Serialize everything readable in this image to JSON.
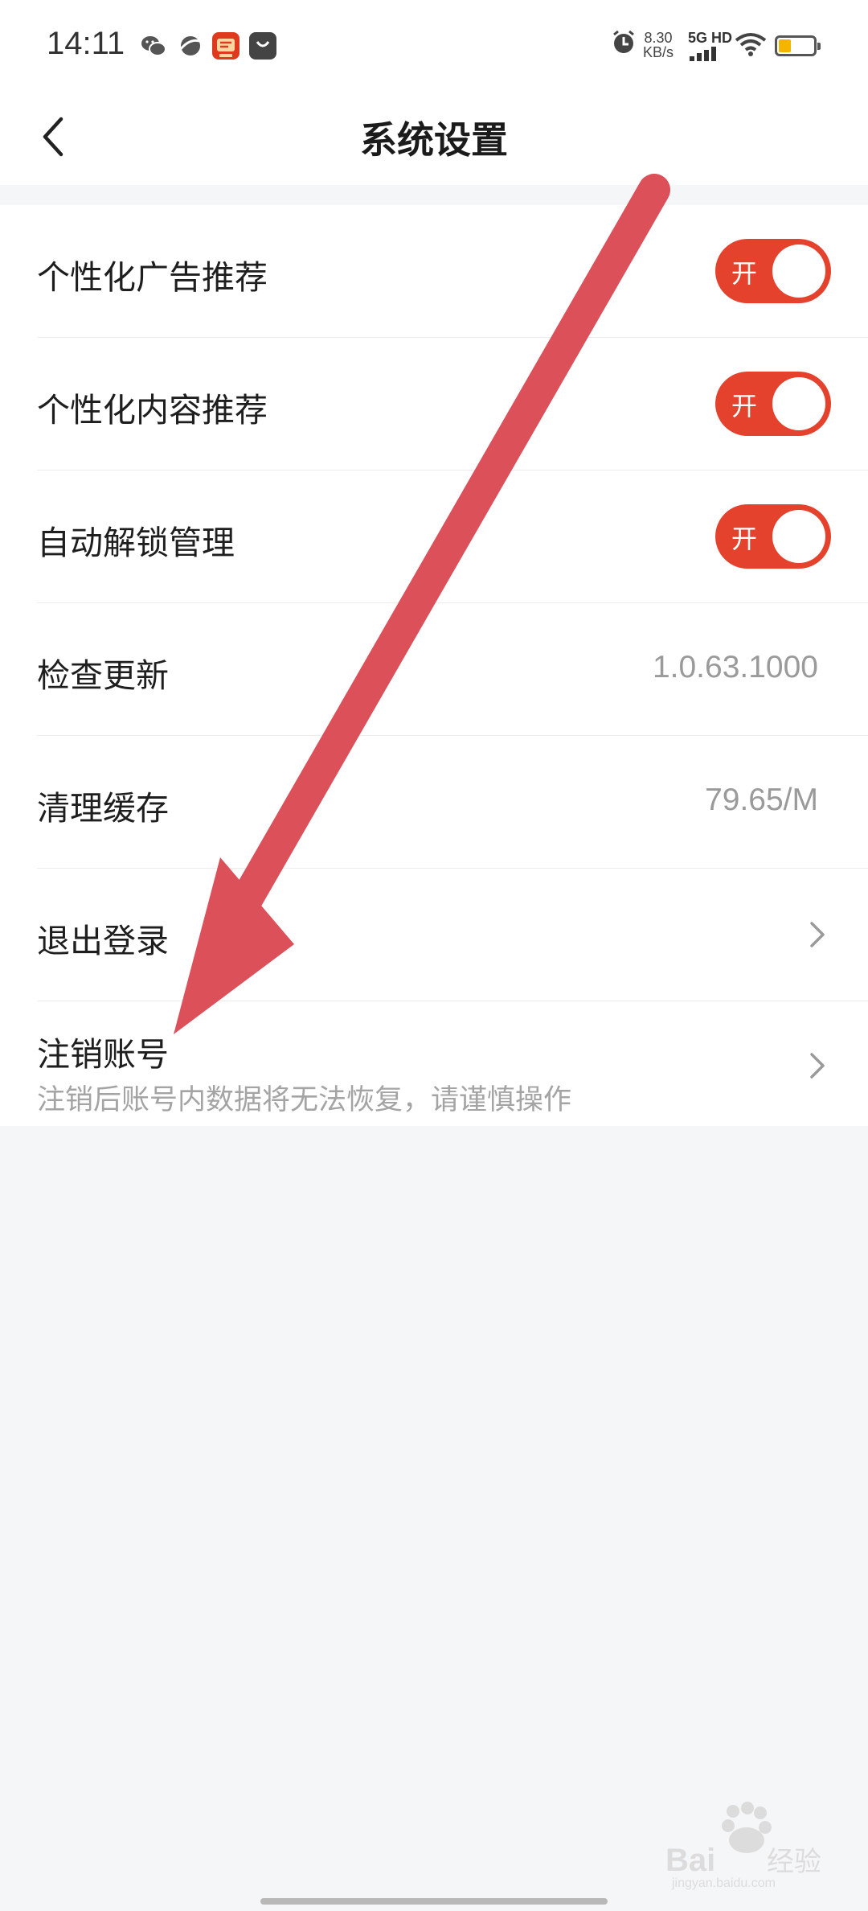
{
  "status_bar": {
    "time": "14:11",
    "app_icons": [
      "wechat-icon",
      "browser-icon",
      "taobao-icon",
      "shopping-bag-icon"
    ],
    "net_speed_value": "8.30",
    "net_speed_unit": "KB/s",
    "network_label": "5G HD",
    "battery_level": 0.35,
    "battery_color": "#f5b400"
  },
  "header": {
    "back_icon": "chevron-left-icon",
    "title": "系统设置"
  },
  "settings": {
    "items": [
      {
        "label": "个性化广告推荐",
        "type": "toggle",
        "toggle_text": "开",
        "on": true
      },
      {
        "label": "个性化内容推荐",
        "type": "toggle",
        "toggle_text": "开",
        "on": true
      },
      {
        "label": "自动解锁管理",
        "type": "toggle",
        "toggle_text": "开",
        "on": true
      },
      {
        "label": "检查更新",
        "type": "value",
        "value": "1.0.63.1000"
      },
      {
        "label": "清理缓存",
        "type": "value",
        "value": "79.65/M"
      },
      {
        "label": "退出登录",
        "type": "link"
      },
      {
        "label": "注销账号",
        "type": "link",
        "subtitle": "注销后账号内数据将无法恢复，请谨慎操作"
      }
    ]
  },
  "colors": {
    "accent": "#e5422d",
    "annotation_arrow": "#dc505a",
    "background": "#f5f6f8"
  },
  "watermark": {
    "brand": "Bai du 经验",
    "url": "jingyan.baidu.com"
  }
}
